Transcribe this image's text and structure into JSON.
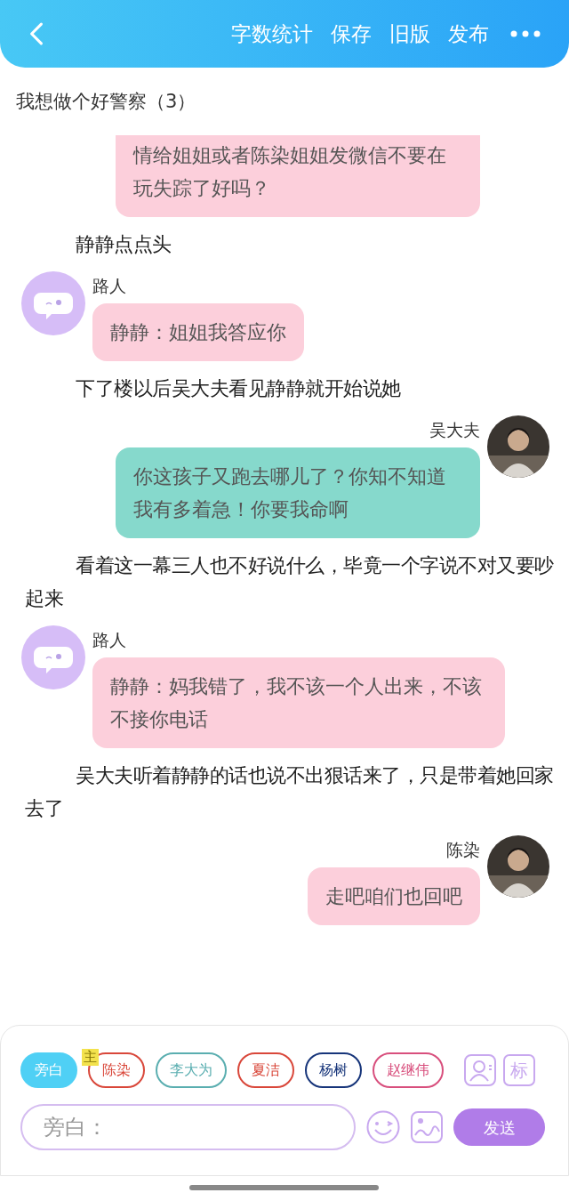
{
  "header": {
    "actions": [
      "字数统计",
      "保存",
      "旧版",
      "发布"
    ]
  },
  "chapter_title": "我想做个好警察（3）",
  "messages": [
    {
      "kind": "right",
      "clipped_top": true,
      "color": "#fccfdb",
      "text": "情给姐姐或者陈染姐姐发微信不要在玩失踪了好吗？"
    },
    {
      "kind": "narration",
      "text": "静静点点头"
    },
    {
      "kind": "left",
      "speaker": "路人",
      "color": "#fccfdb",
      "text": "静静：姐姐我答应你"
    },
    {
      "kind": "narration",
      "text": "下了楼以后吴大夫看见静静就开始说她"
    },
    {
      "kind": "right",
      "speaker": "吴大夫",
      "color": "#86d9cc",
      "text": "你这孩子又跑去哪儿了？你知不知道我有多着急！你要我命啊"
    },
    {
      "kind": "narration",
      "text": "看着这一幕三人也不好说什么，毕竟一个字说不对又要吵起来"
    },
    {
      "kind": "left",
      "speaker": "路人",
      "color": "#fccfdb",
      "text": "静静：妈我错了，我不该一个人出来，不该不接你电话"
    },
    {
      "kind": "narration",
      "text": "吴大夫听着静静的话也说不出狠话来了，只是带着她回家去了"
    },
    {
      "kind": "right",
      "speaker": "陈染",
      "color": "#fccfdb",
      "text": "走吧咱们也回吧"
    }
  ],
  "characters": [
    {
      "name": "旁白",
      "selected": true,
      "color": "#4fd0f5"
    },
    {
      "name": "陈染",
      "selected": false,
      "color": "#d9473a",
      "badge": "主"
    },
    {
      "name": "李大为",
      "selected": false,
      "color": "#5aaeb0"
    },
    {
      "name": "夏洁",
      "selected": false,
      "color": "#d9473a"
    },
    {
      "name": "杨树",
      "selected": false,
      "color": "#17357a"
    },
    {
      "name": "赵继伟",
      "selected": false,
      "color": "#d84f7d"
    }
  ],
  "tool_buttons": [
    "标"
  ],
  "input": {
    "placeholder": "旁白："
  },
  "send_label": "发送"
}
